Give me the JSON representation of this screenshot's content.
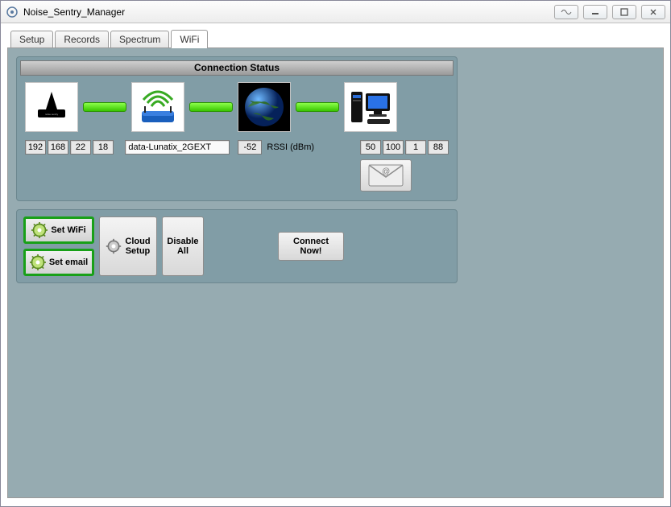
{
  "window": {
    "title": "Noise_Sentry_Manager"
  },
  "tabs": {
    "setup": "Setup",
    "records": "Records",
    "spectrum": "Spectrum",
    "wifi": "WiFi"
  },
  "status": {
    "title": "Connection Status",
    "device_ip": [
      "192",
      "168",
      "22",
      "18"
    ],
    "ssid": "data-Lunatix_2GEXT",
    "rssi_value": "-52",
    "rssi_label": "RSSI (dBm)",
    "server_ip": [
      "50",
      "100",
      "1",
      "88"
    ]
  },
  "buttons": {
    "set_wifi": "Set WiFi",
    "set_email": "Set email",
    "cloud_setup": "Cloud\nSetup",
    "disable_all": "Disable\nAll",
    "connect_now": "Connect\nNow!"
  }
}
